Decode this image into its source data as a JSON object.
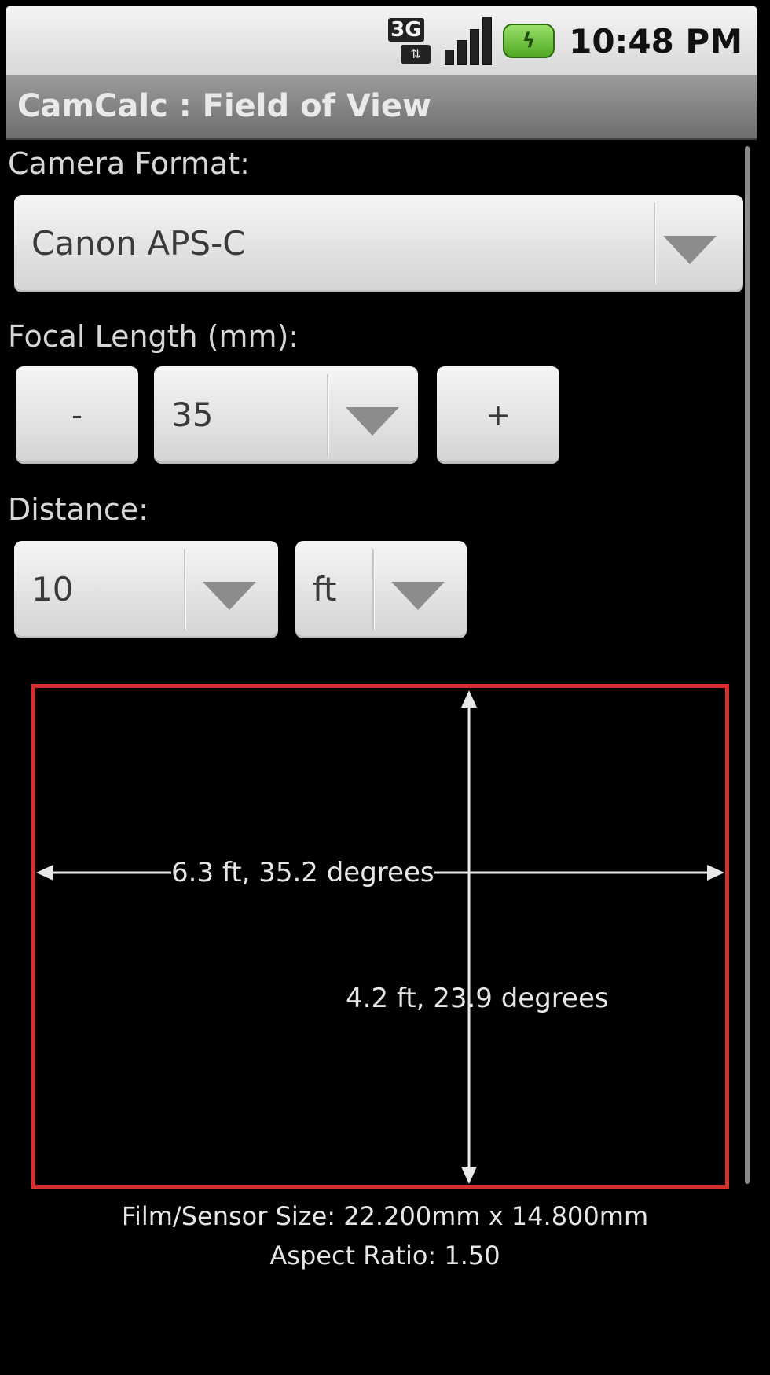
{
  "status_bar": {
    "network": "3G",
    "time": "10:48 PM",
    "icons": [
      "network-3g-icon",
      "signal-strength-icon",
      "battery-charging-icon"
    ]
  },
  "title": "CamCalc : Field of View",
  "camera_format": {
    "label": "Camera Format:",
    "selected": "Canon APS-C"
  },
  "focal_length": {
    "label": "Focal Length (mm):",
    "decrement": "-",
    "selected": "35",
    "increment": "+"
  },
  "distance": {
    "label": "Distance:",
    "value": "10",
    "unit": "ft"
  },
  "fov": {
    "horizontal": "6.3 ft, 35.2 degrees",
    "vertical": "4.2 ft, 23.9 degrees",
    "frame_color": "#d62f2f"
  },
  "info": {
    "sensor_size": "Film/Sensor Size: 22.200mm x 14.800mm",
    "aspect_ratio": "Aspect Ratio: 1.50"
  }
}
